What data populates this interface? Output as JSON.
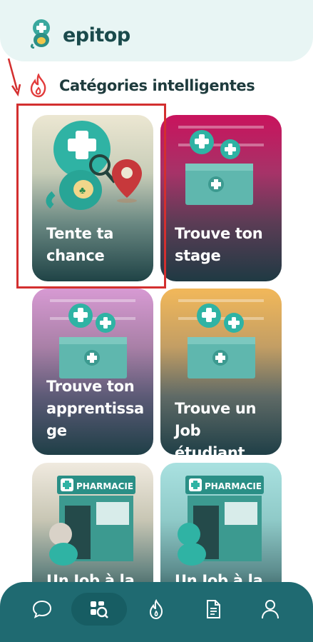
{
  "app": {
    "name": "epitop"
  },
  "section": {
    "title": "Catégories intelligentes"
  },
  "cards": [
    {
      "label": "Tente ta chance"
    },
    {
      "label": "Trouve ton stage"
    },
    {
      "label": "Trouve ton apprentissa ge"
    },
    {
      "label": "Trouve un Job étudiant"
    },
    {
      "label": "Un Job à la"
    },
    {
      "label": "Un Job à la"
    }
  ],
  "illustration_text": {
    "pharmacy_sign": "PHARMACIE"
  },
  "nav": {
    "items": [
      {
        "icon": "chat-bubble-icon"
      },
      {
        "icon": "search-catalog-icon",
        "active": true
      },
      {
        "icon": "flame-icon"
      },
      {
        "icon": "document-icon"
      },
      {
        "icon": "user-icon"
      }
    ]
  },
  "colors": {
    "brand_teal": "#1f6a71",
    "highlight_red": "#d32f2f",
    "header_bg": "#e8f5f4"
  }
}
